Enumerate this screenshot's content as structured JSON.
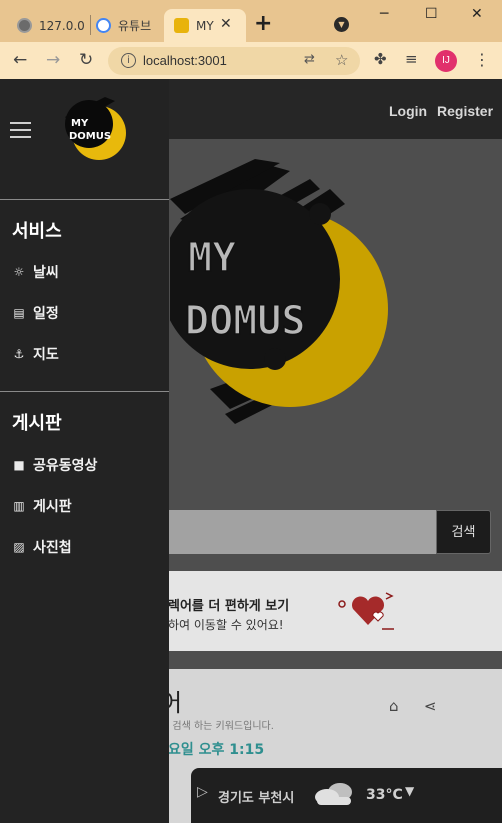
{
  "browser": {
    "tabs": [
      {
        "label": "127.0.0",
        "icon": "globe-icon"
      },
      {
        "label": "유튜브",
        "icon": "google-icon"
      },
      {
        "label": "MY",
        "icon": "mydomus-favicon"
      }
    ],
    "close_glyph": "✕",
    "new_tab_glyph": "+",
    "address": "localhost:3001",
    "profile_initials": "IJ"
  },
  "header": {
    "login": "Login",
    "register": "Register"
  },
  "logo": {
    "line1": "MY",
    "line2": "DOMUS"
  },
  "search": {
    "button": "검색"
  },
  "promo": {
    "line1": "렉어를 더 편하게 보기",
    "line2": "하여 이동할 수 있어요!"
  },
  "card": {
    "title": "어",
    "subtitle": "세 검색 하는 키워드입니다.",
    "time": "요일 오후 1:15"
  },
  "weather": {
    "location": "경기도 부천시",
    "temperature": "33°C"
  },
  "sidebar": {
    "services_title": "서비스",
    "services": [
      {
        "label": "날씨",
        "icon": "sun-icon"
      },
      {
        "label": "일정",
        "icon": "calendar-icon"
      },
      {
        "label": "지도",
        "icon": "anchor-icon"
      }
    ],
    "board_title": "게시판",
    "boards": [
      {
        "label": "공유동영상",
        "icon": "video-icon"
      },
      {
        "label": "게시판",
        "icon": "columns-icon"
      },
      {
        "label": "사진첩",
        "icon": "image-icon"
      }
    ]
  },
  "colors": {
    "chrome_tabbar": "#e8c590",
    "chrome_toolbar": "#fbe6c0",
    "sidebar_bg": "#232323",
    "moon_gold": "#c9a100",
    "time_teal": "#2f8f8f"
  }
}
